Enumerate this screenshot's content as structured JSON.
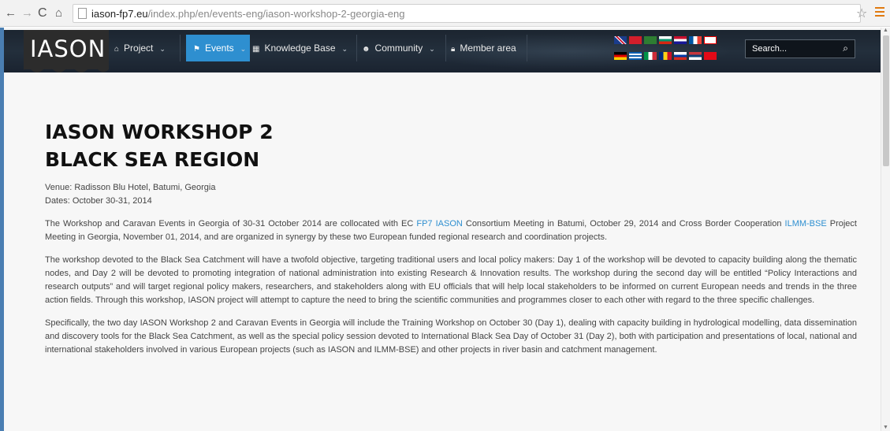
{
  "browser": {
    "url_host": "iason-fp7.eu",
    "url_path": "/index.php/en/events-eng/iason-workshop-2-georgia-eng"
  },
  "site": {
    "logo_text": "IASON",
    "nav": [
      {
        "label": "Project",
        "icon": "home-icon"
      },
      {
        "label": "Events",
        "icon": "flag-icon"
      },
      {
        "label": "Knowledge Base",
        "icon": "grid-icon"
      },
      {
        "label": "Community",
        "icon": "users-icon"
      },
      {
        "label": "Member area",
        "icon": "lock-icon"
      }
    ],
    "search_placeholder": "Search..."
  },
  "article": {
    "title_line1": "IASON WORKSHOP 2",
    "title_line2": "BLACK SEA REGION",
    "venue": "Venue: Radisson Blu Hotel, Batumi, Georgia",
    "dates": "Dates: October 30-31, 2014",
    "p1_a": "The Workshop and Caravan Events in Georgia of 30-31 October 2014 are collocated with EC ",
    "p1_link1": "FP7 IASON",
    "p1_b": " Consortium Meeting in Batumi, October 29, 2014 and Cross Border Cooperation ",
    "p1_link2": "ILMM-BSE",
    "p1_c": " Project Meeting in Georgia, November 01, 2014, and are organized in synergy by these two European funded regional research and coordination projects.",
    "p2": "The workshop devoted to the Black Sea Catchment will have a twofold objective, targeting traditional users and local policy makers: Day 1 of the workshop will be devoted to capacity building along the thematic nodes, and Day 2 will be devoted to promoting integration of national administration into existing Research & Innovation results. The workshop during the second day will be entitled “Policy Interactions and research outputs” and will target regional policy makers, researchers, and stakeholders along with EU officials that will help local stakeholders to be informed on current European needs and trends in the three action fields. Through this workshop, IASON project will attempt to capture the need to bring the scientific communities and programmes closer to each other with regard to the three specific challenges.",
    "p3": "Specifically, the two day IASON Workshop 2 and Caravan Events in Georgia will include the Training Workshop on October 30 (Day 1), dealing with capacity building in hydrological modelling, data dissemination and discovery tools for the Black Sea Catchment, as well as the special policy session devoted to International Black Sea Day of October 31 (Day 2), both with participation and presentations of local, national and international stakeholders involved in various European projects (such as IASON and ILMM-BSE) and other projects in river basin and catchment management."
  },
  "colors": {
    "accent": "#2e8fd0",
    "nav_bg": "#1f2a36",
    "page_bg": "#f7f7f7"
  }
}
